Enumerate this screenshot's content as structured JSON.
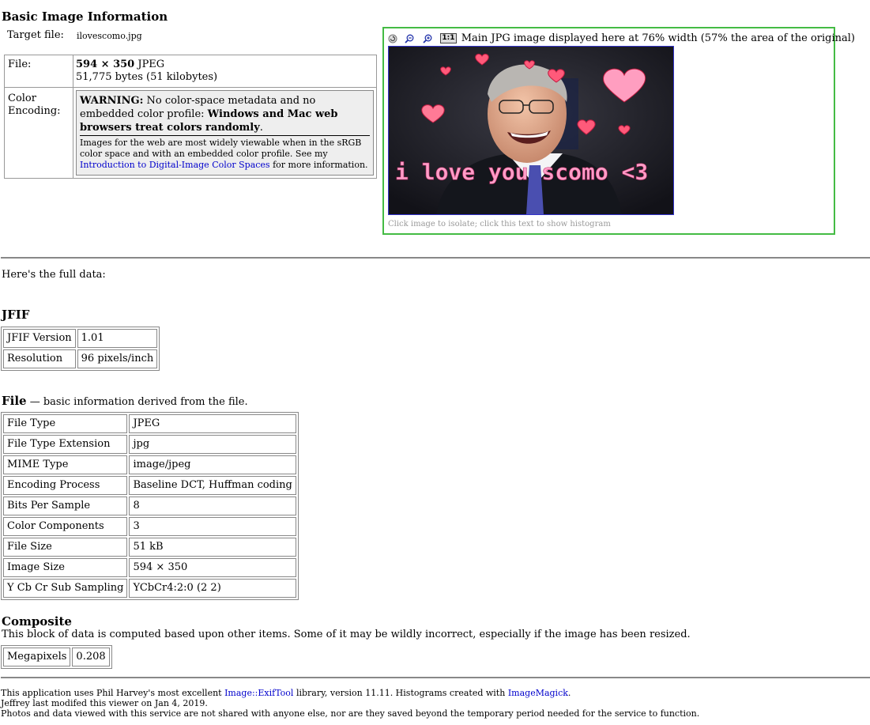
{
  "basic": {
    "title": "Basic Image Information",
    "target_label": "Target file:",
    "target_value": "ilovescomo.jpg",
    "file_label": "File:",
    "file_dims": "594 × 350",
    "file_format": " JPEG",
    "file_bytes": "51,775 bytes (51 kilobytes)",
    "color_label": "Color Encoding:",
    "warning_strong": "WARNING:",
    "warning_text": " No color-space metadata and no embedded color profile: ",
    "warning_bold": "Windows and Mac web browsers treat colors randomly",
    "warning_end": ".",
    "note_text": "Images for the web are most widely viewable when in the sRGB color space and with an embedded color profile. See my ",
    "note_link": "Introduction to Digital-Image Color Spaces",
    "note_end": " for more information."
  },
  "preview": {
    "caption": "Main JPG image displayed here at 76% width (57% the area of the original)",
    "zoom_label": "1:1",
    "image_text": "i love you scomo <3",
    "hint": "Click image to isolate; click this text to show histogram"
  },
  "full_data_intro": "Here's the full data:",
  "jfif": {
    "title": "JFIF",
    "rows": [
      {
        "k": "JFIF Version",
        "v": "1.01"
      },
      {
        "k": "Resolution",
        "v": "96 pixels/inch"
      }
    ]
  },
  "file_section": {
    "title": "File",
    "subtitle": " — basic information derived from the file.",
    "rows": [
      {
        "k": "File Type",
        "v": "JPEG"
      },
      {
        "k": "File Type Extension",
        "v": "jpg"
      },
      {
        "k": "MIME Type",
        "v": "image/jpeg"
      },
      {
        "k": "Encoding Process",
        "v": "Baseline DCT, Huffman coding"
      },
      {
        "k": "Bits Per Sample",
        "v": "8"
      },
      {
        "k": "Color Components",
        "v": "3"
      },
      {
        "k": "File Size",
        "v": "51 kB"
      },
      {
        "k": "Image Size",
        "v": "594 × 350"
      },
      {
        "k": "Y Cb Cr Sub Sampling",
        "v": "YCbCr4:2:0 (2 2)"
      }
    ]
  },
  "composite": {
    "title": "Composite",
    "desc": "This block of data is computed based upon other items. Some of it may be wildly incorrect, especially if the image has been resized.",
    "rows": [
      {
        "k": "Megapixels",
        "v": "0.208"
      }
    ]
  },
  "footer": {
    "line1_pre": "This application uses Phil Harvey's most excellent ",
    "line1_link1": "Image::ExifTool",
    "line1_mid": " library, version 11.11. Histograms created with ",
    "line1_link2": "ImageMagick",
    "line1_end": ".",
    "line2": "Jeffrey last modifed this viewer on Jan 4, 2019.",
    "line3": "Photos and data viewed with this service are not shared with anyone else, nor are they saved beyond the temporary period needed for the service to function."
  },
  "colors": {
    "preview_border": "#44bb44",
    "link": "#0000cc",
    "warning_bg": "#eeeeee",
    "heart": "#ff5a7a",
    "image_text": "#ff9ec8"
  }
}
